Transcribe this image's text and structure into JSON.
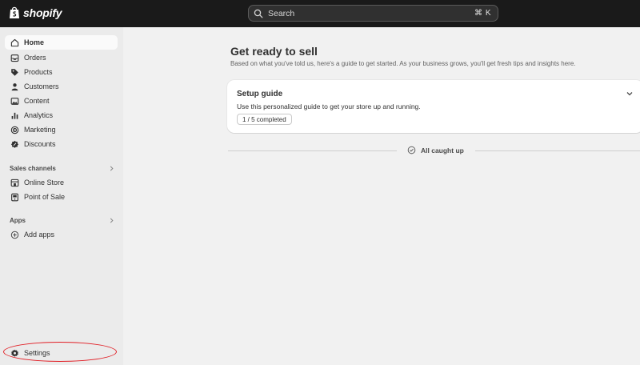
{
  "topbar": {
    "brand": "shopify",
    "search_placeholder": "Search",
    "search_shortcut": "⌘ K"
  },
  "sidebar": {
    "items": [
      {
        "label": "Home",
        "icon": "home-icon",
        "active": true
      },
      {
        "label": "Orders",
        "icon": "inbox-icon"
      },
      {
        "label": "Products",
        "icon": "tag-icon"
      },
      {
        "label": "Customers",
        "icon": "person-icon"
      },
      {
        "label": "Content",
        "icon": "image-icon"
      },
      {
        "label": "Analytics",
        "icon": "bar-chart-icon"
      },
      {
        "label": "Marketing",
        "icon": "target-icon"
      },
      {
        "label": "Discounts",
        "icon": "discount-icon"
      }
    ],
    "sales_channels": {
      "label": "Sales channels",
      "items": [
        {
          "label": "Online Store",
          "icon": "store-icon"
        },
        {
          "label": "Point of Sale",
          "icon": "pos-icon"
        }
      ]
    },
    "apps": {
      "label": "Apps",
      "items": [
        {
          "label": "Add apps",
          "icon": "plus-circle-icon"
        }
      ]
    },
    "settings": {
      "label": "Settings",
      "icon": "gear-icon"
    }
  },
  "main": {
    "title": "Get ready to sell",
    "subtitle": "Based on what you've told us, here's a guide to get started. As your business grows, you'll get fresh tips and insights here.",
    "setup_card": {
      "title": "Setup guide",
      "description": "Use this personalized guide to get your store up and running.",
      "progress": "1 / 5 completed"
    },
    "caught_up": "All caught up"
  },
  "colors": {
    "topbar": "#1a1a1a",
    "sidebar": "#ebebeb",
    "background": "#f1f1f1",
    "annotation_ring": "#e11d24"
  }
}
